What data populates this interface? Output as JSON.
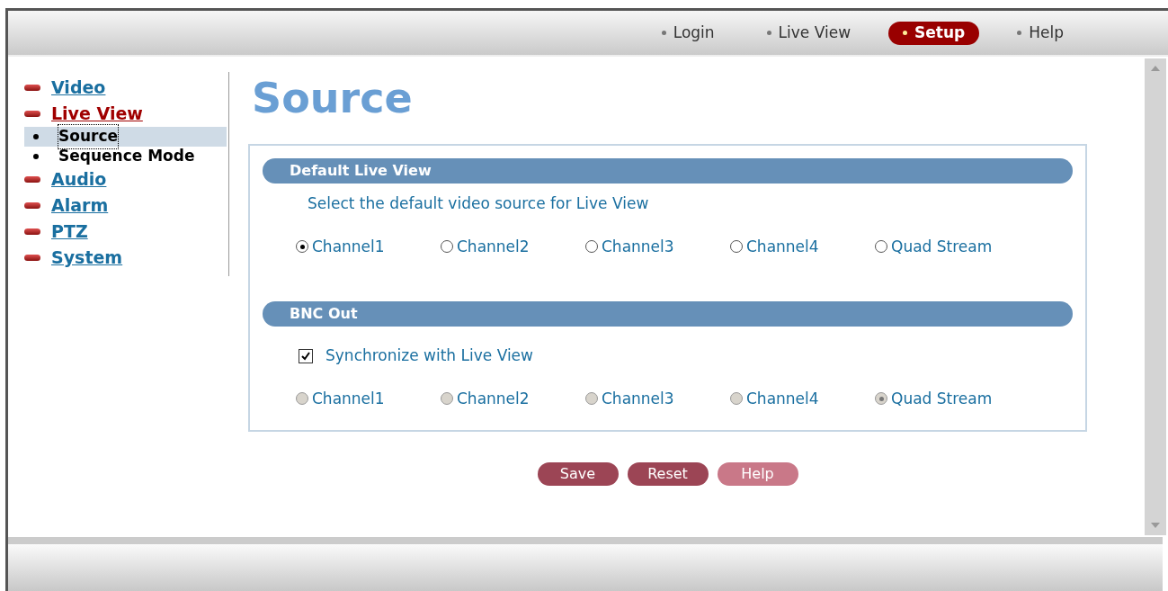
{
  "top_nav": [
    {
      "label": "Login",
      "selected": false
    },
    {
      "label": "Live View",
      "selected": false
    },
    {
      "label": "Setup",
      "selected": true
    },
    {
      "label": "Help",
      "selected": false
    }
  ],
  "sidebar": {
    "items": [
      {
        "label": "Video",
        "selected": false
      },
      {
        "label": "Live View",
        "selected": true,
        "children": [
          {
            "label": "Source",
            "selected": true
          },
          {
            "label": "Sequence Mode",
            "selected": false
          }
        ]
      },
      {
        "label": "Audio",
        "selected": false
      },
      {
        "label": "Alarm",
        "selected": false
      },
      {
        "label": "PTZ",
        "selected": false
      },
      {
        "label": "System",
        "selected": false
      }
    ]
  },
  "page_title": "Source",
  "sections": [
    {
      "title": "Default Live View",
      "description": "Select the default video source for Live View",
      "options": [
        {
          "label": "Channel1",
          "selected": true,
          "disabled": false
        },
        {
          "label": "Channel2",
          "selected": false,
          "disabled": false
        },
        {
          "label": "Channel3",
          "selected": false,
          "disabled": false
        },
        {
          "label": "Channel4",
          "selected": false,
          "disabled": false
        },
        {
          "label": "Quad Stream",
          "selected": false,
          "disabled": false
        }
      ]
    },
    {
      "title": "BNC Out",
      "checkbox": {
        "label": "Synchronize with Live View",
        "checked": true
      },
      "options": [
        {
          "label": "Channel1",
          "selected": false,
          "disabled": true
        },
        {
          "label": "Channel2",
          "selected": false,
          "disabled": true
        },
        {
          "label": "Channel3",
          "selected": false,
          "disabled": true
        },
        {
          "label": "Channel4",
          "selected": false,
          "disabled": true
        },
        {
          "label": "Quad Stream",
          "selected": true,
          "disabled": true
        }
      ]
    }
  ],
  "buttons": [
    {
      "label": "Save",
      "disabled": false
    },
    {
      "label": "Reset",
      "disabled": false
    },
    {
      "label": "Help",
      "disabled": true
    }
  ]
}
